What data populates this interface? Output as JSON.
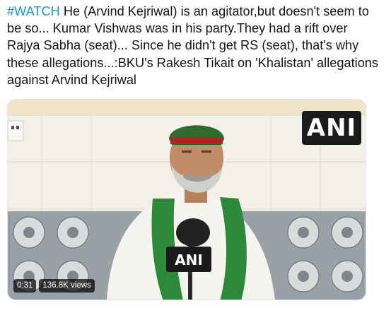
{
  "tweet": {
    "hashtag": "#WATCH",
    "text": " He (Arvind Kejriwal) is an agitator,but doesn't seem to be so... Kumar Vishwas was in his party.They had a rift over Rajya Sabha (seat)... Since he didn't get RS (seat), that's why these allegations...:BKU's Rakesh Tikait on 'Khalistan' allegations against Arvind Kejriwal"
  },
  "video": {
    "logo": "ANI",
    "mic_label": "ANI",
    "duration": "0:31",
    "views": "136.8K views"
  },
  "colors": {
    "hashtag": "#1b95e0",
    "text": "#14171a",
    "cap_green": "#2e6b2e",
    "cap_red": "#b22222"
  }
}
